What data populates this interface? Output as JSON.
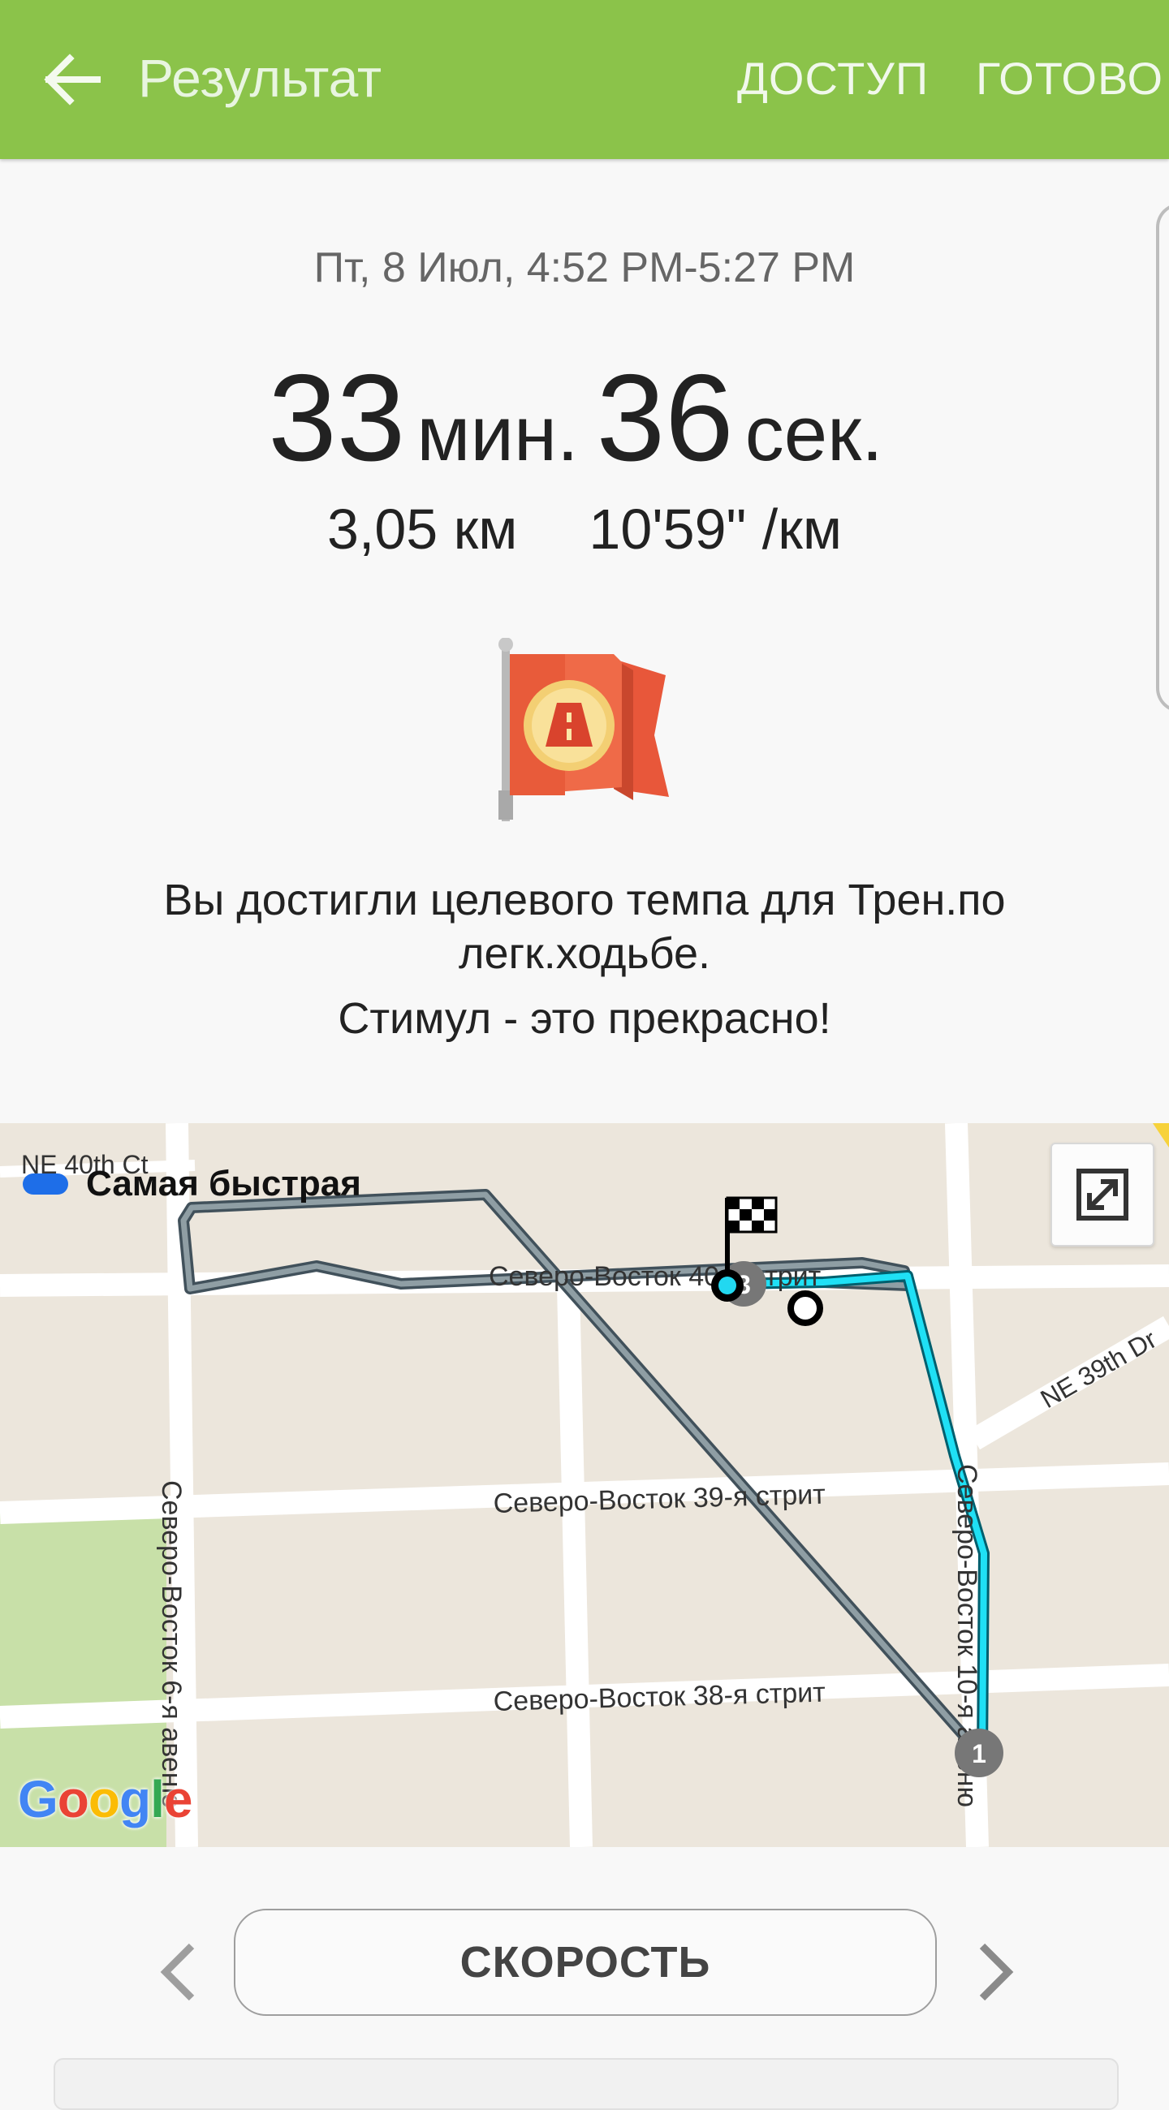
{
  "header": {
    "title": "Результат",
    "share_label": "ДОСТУП",
    "done_label": "ГОТОВО"
  },
  "summary": {
    "datetime": "Пт, 8 Июл, 4:52 PM-5:27 PM",
    "duration_minutes": "33",
    "minutes_unit": "мин.",
    "duration_seconds": "36",
    "seconds_unit": "сек.",
    "distance": "3,05 км",
    "pace": "10'59\" /км"
  },
  "achievement": {
    "icon": "flag-badge-icon",
    "line1": "Вы достигли целевого темпа для Трен.по легк.ходьбе.",
    "line2": "Стимул - это прекрасно!"
  },
  "map": {
    "legend_label": "Самая быстрая",
    "legend_color": "#1e6ee8",
    "route_color": "#6d8088",
    "fast_segment_color": "#00e5ff",
    "streets": {
      "ne40th": "NE 40th Ct",
      "ne39thdr": "NE 39th Dr",
      "sv40": "Северо-Восток 40-я стрит",
      "sv39": "Северо-Восток 39-я стрит",
      "sv38": "Северо-Восток 38-я стрит",
      "sv6av": "Северо-Восток 6-я авеню",
      "sv10av": "Северо-Восток 10-я авеню"
    },
    "markers": {
      "start": "1",
      "lap": "3"
    },
    "logo": "Google"
  },
  "footer": {
    "metric_label": "СКОРОСТЬ"
  },
  "colors": {
    "appbar": "#8bc34a",
    "flag": "#e8573a",
    "badge": "#f6dc86"
  }
}
